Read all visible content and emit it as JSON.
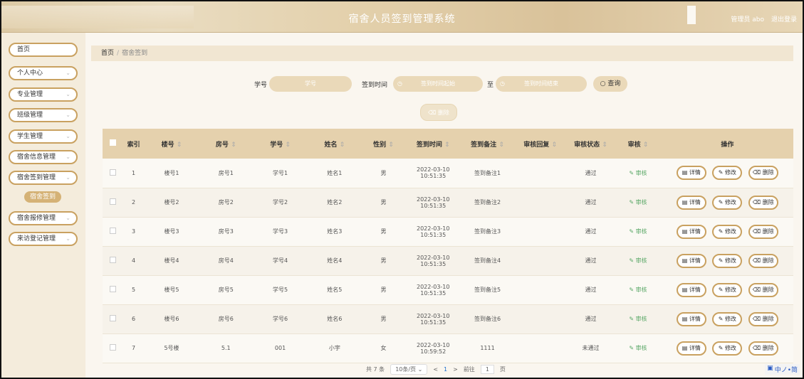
{
  "header": {
    "title": "宿舍人员签到管理系统",
    "user": "管理员 abo",
    "logout": "退出登录"
  },
  "sidebar": {
    "items": [
      {
        "label": "首页",
        "has_chevron": false
      },
      {
        "label": "个人中心",
        "has_chevron": true
      },
      {
        "label": "专业管理",
        "has_chevron": true
      },
      {
        "label": "班级管理",
        "has_chevron": true
      },
      {
        "label": "学生管理",
        "has_chevron": true
      },
      {
        "label": "宿舍信息管理",
        "has_chevron": true
      },
      {
        "label": "宿舍签到管理",
        "has_chevron": true
      }
    ],
    "active_sub": "宿舍签到",
    "items_after": [
      {
        "label": "宿舍报修管理",
        "has_chevron": true
      },
      {
        "label": "来访登记管理",
        "has_chevron": true
      }
    ]
  },
  "breadcrumb": {
    "home": "首页",
    "sep": "/",
    "current": "宿舍签到"
  },
  "search": {
    "student_no_label": "学号",
    "student_no_placeholder": "学号",
    "time_label": "签到时间",
    "time_start_placeholder": "签到时间起始",
    "range_sep": "至",
    "time_end_placeholder": "签到时间结束",
    "query_button": "查询"
  },
  "actions": {
    "delete_label": "删除"
  },
  "table": {
    "headers": [
      "索引",
      "楼号",
      "房号",
      "学号",
      "姓名",
      "性别",
      "签到时间",
      "签到备注",
      "审核回复",
      "审核状态",
      "审核",
      "操作"
    ],
    "rows": [
      {
        "index": "1",
        "building": "楼号1",
        "room": "房号1",
        "student_no": "学号1",
        "name": "姓名1",
        "gender": "男",
        "time": "2022-03-10 10:51:35",
        "remark": "签到备注1",
        "reply": "",
        "status": "通过",
        "audit": "审核"
      },
      {
        "index": "2",
        "building": "楼号2",
        "room": "房号2",
        "student_no": "学号2",
        "name": "姓名2",
        "gender": "男",
        "time": "2022-03-10 10:51:35",
        "remark": "签到备注2",
        "reply": "",
        "status": "通过",
        "audit": "审核"
      },
      {
        "index": "3",
        "building": "楼号3",
        "room": "房号3",
        "student_no": "学号3",
        "name": "姓名3",
        "gender": "男",
        "time": "2022-03-10 10:51:35",
        "remark": "签到备注3",
        "reply": "",
        "status": "通过",
        "audit": "审核"
      },
      {
        "index": "4",
        "building": "楼号4",
        "room": "房号4",
        "student_no": "学号4",
        "name": "姓名4",
        "gender": "男",
        "time": "2022-03-10 10:51:35",
        "remark": "签到备注4",
        "reply": "",
        "status": "通过",
        "audit": "审核"
      },
      {
        "index": "5",
        "building": "楼号5",
        "room": "房号5",
        "student_no": "学号5",
        "name": "姓名5",
        "gender": "男",
        "time": "2022-03-10 10:51:35",
        "remark": "签到备注5",
        "reply": "",
        "status": "通过",
        "audit": "审核"
      },
      {
        "index": "6",
        "building": "楼号6",
        "room": "房号6",
        "student_no": "学号6",
        "name": "姓名6",
        "gender": "男",
        "time": "2022-03-10 10:51:35",
        "remark": "签到备注6",
        "reply": "",
        "status": "通过",
        "audit": "审核"
      },
      {
        "index": "7",
        "building": "5号楼",
        "room": "5.1",
        "student_no": "001",
        "name": "小宇",
        "gender": "女",
        "time": "2022-03-10 10:59:52",
        "remark": "1111",
        "reply": "",
        "status": "未通过",
        "audit": "审核"
      }
    ],
    "op_labels": {
      "detail": "详情",
      "edit": "修改",
      "delete": "删除"
    }
  },
  "pagination": {
    "total": "共 7 条",
    "page_size": "10条/页",
    "prev": "<",
    "current_page": "1",
    "next": ">",
    "goto_label": "前往",
    "goto_value": "1",
    "page_suffix": "页"
  },
  "tray": {
    "text": "中ノ•简"
  },
  "colors": {
    "accent": "#c9a160",
    "header_bg": "#dcc9a4",
    "table_header_bg": "#e5d1ad",
    "audit_green": "#5aa867"
  }
}
